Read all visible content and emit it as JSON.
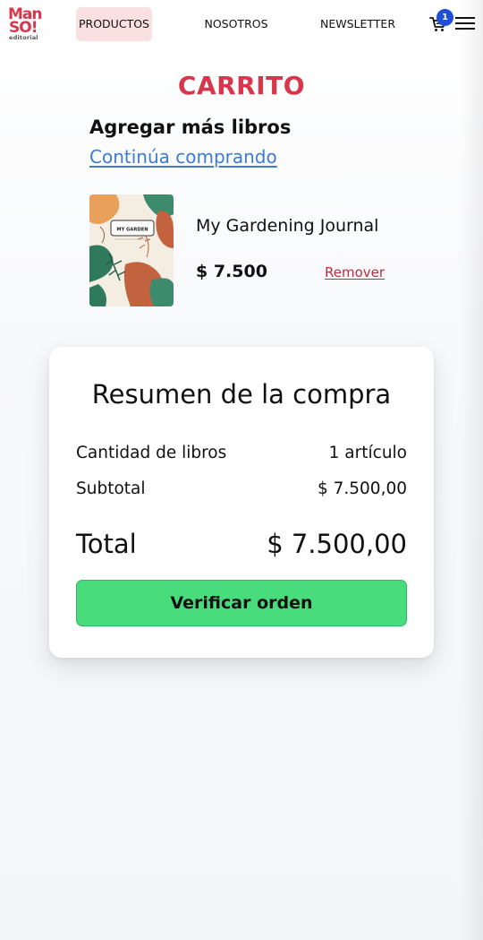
{
  "header": {
    "logo": {
      "line1": "Man",
      "line2": "SO!",
      "line3": "editorial"
    },
    "nav": {
      "productos": "PRODUCTOS",
      "nosotros": "NOSOTROS",
      "newsletter": "NEWSLETTER"
    },
    "cart_count": "1",
    "accent_color": "#d8364b",
    "badge_color": "#1e4fd6"
  },
  "cart": {
    "title": "CARRITO",
    "add_more": "Agregar más libros",
    "continue_link": "Continúa comprando",
    "items": [
      {
        "title": "My Gardening Journal",
        "price": "$ 7.500",
        "remove_label": "Remover",
        "cover_label": "MY GARDEN"
      }
    ]
  },
  "summary": {
    "title": "Resumen de la compra",
    "quantity_label": "Cantidad de libros",
    "quantity_value": "1 artículo",
    "subtotal_label": "Subtotal",
    "subtotal_value": "$ 7.500,00",
    "total_label": "Total",
    "total_value": "$ 7.500,00",
    "checkout_button": "Verificar orden",
    "button_color": "#48dc7c"
  }
}
